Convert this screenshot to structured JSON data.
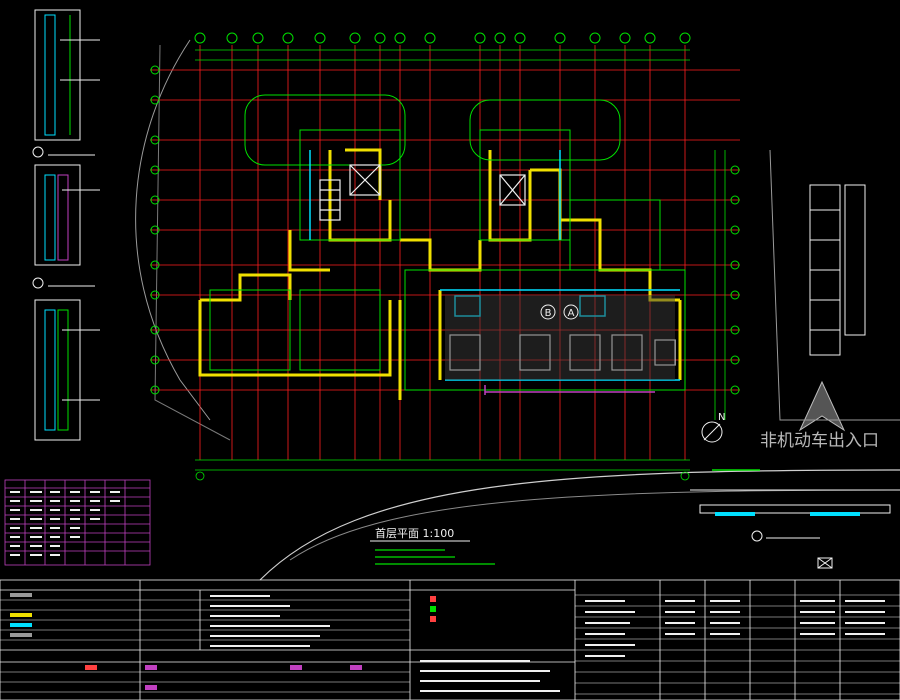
{
  "drawing": {
    "scale_title": "首层平面 1:100",
    "watermark_text": "非机动车出入口",
    "north_letter": "N",
    "axis_letters": [
      "B",
      "A"
    ]
  },
  "colors": {
    "background": "#000000",
    "grid": "#ff1e1e",
    "wall": "#f0e000",
    "outline": "#00e000",
    "structure": "#f0f0f0",
    "accent": "#00e0ff",
    "hatch": "#c040c0",
    "table": "#ffffff"
  },
  "icons": [
    "north-arrow-icon",
    "section-marker-icon",
    "compass-icon"
  ]
}
